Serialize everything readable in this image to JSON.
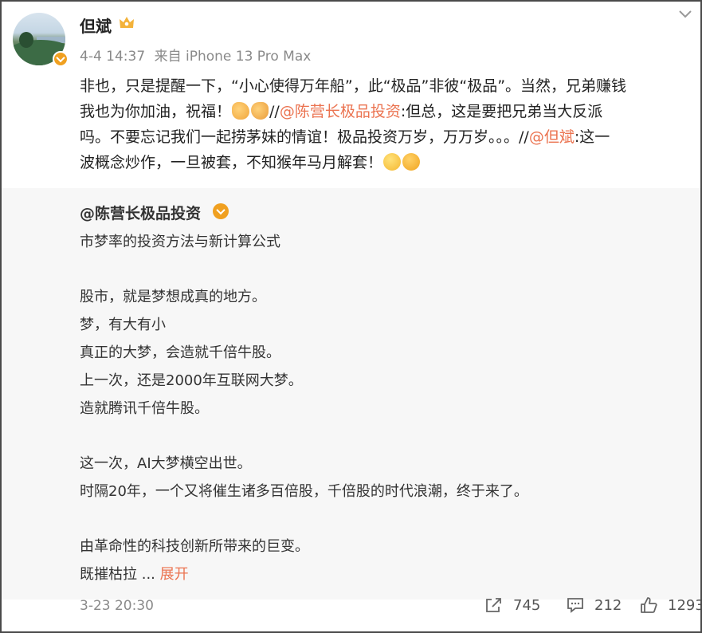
{
  "post": {
    "author": "但斌",
    "meta_time": "4-4 14:37",
    "meta_source": "来自 iPhone 13 Pro Max",
    "line1": "非也，只是提醒一下，“小心使得万年船”，此“极品”非彼“极品”。当然，兄弟赚钱",
    "line2_a": "我也为你加油，祝福！",
    "line2_b": "//",
    "line2_mention": "@陈营长极品投资",
    "line2_c": ":但总，这是要把兄弟当大反派",
    "line3_a": "吗。不要忘记我们一起捞茅妹的情谊！极品投资万岁，万万岁。。。//",
    "line3_mention": "@但斌",
    "line3_b": ":这一",
    "line4": "波概念炒作，一旦被套，不知猴年马月解套！"
  },
  "repost": {
    "author": "@陈营长极品投资",
    "lines": [
      "市梦率的投资方法与新计算公式",
      "",
      "股市，就是梦想成真的地方。",
      "梦，有大有小",
      "真正的大梦，会造就千倍牛股。",
      "上一次，还是2000年互联网大梦。",
      "造就腾讯千倍牛股。",
      "",
      "这一次，AI大梦横空出世。",
      "时隔20年，一个又将催生诸多百倍股，千倍股的时代浪潮，终于来了。",
      "",
      "由革命性的科技创新所带来的巨变。"
    ],
    "last_line": "既摧枯拉",
    "ellipsis": "...",
    "expand_label": "展开",
    "date": "3-23 20:30",
    "share_count": "745",
    "comment_count": "212",
    "like_count": "1293"
  },
  "colors": {
    "mention": "#eb7350",
    "badge": "#f0a020",
    "repost_bg": "#f7f7f7"
  },
  "icons": [
    "crown-icon",
    "chevron-down-icon",
    "share-icon",
    "comment-icon",
    "like-icon"
  ]
}
